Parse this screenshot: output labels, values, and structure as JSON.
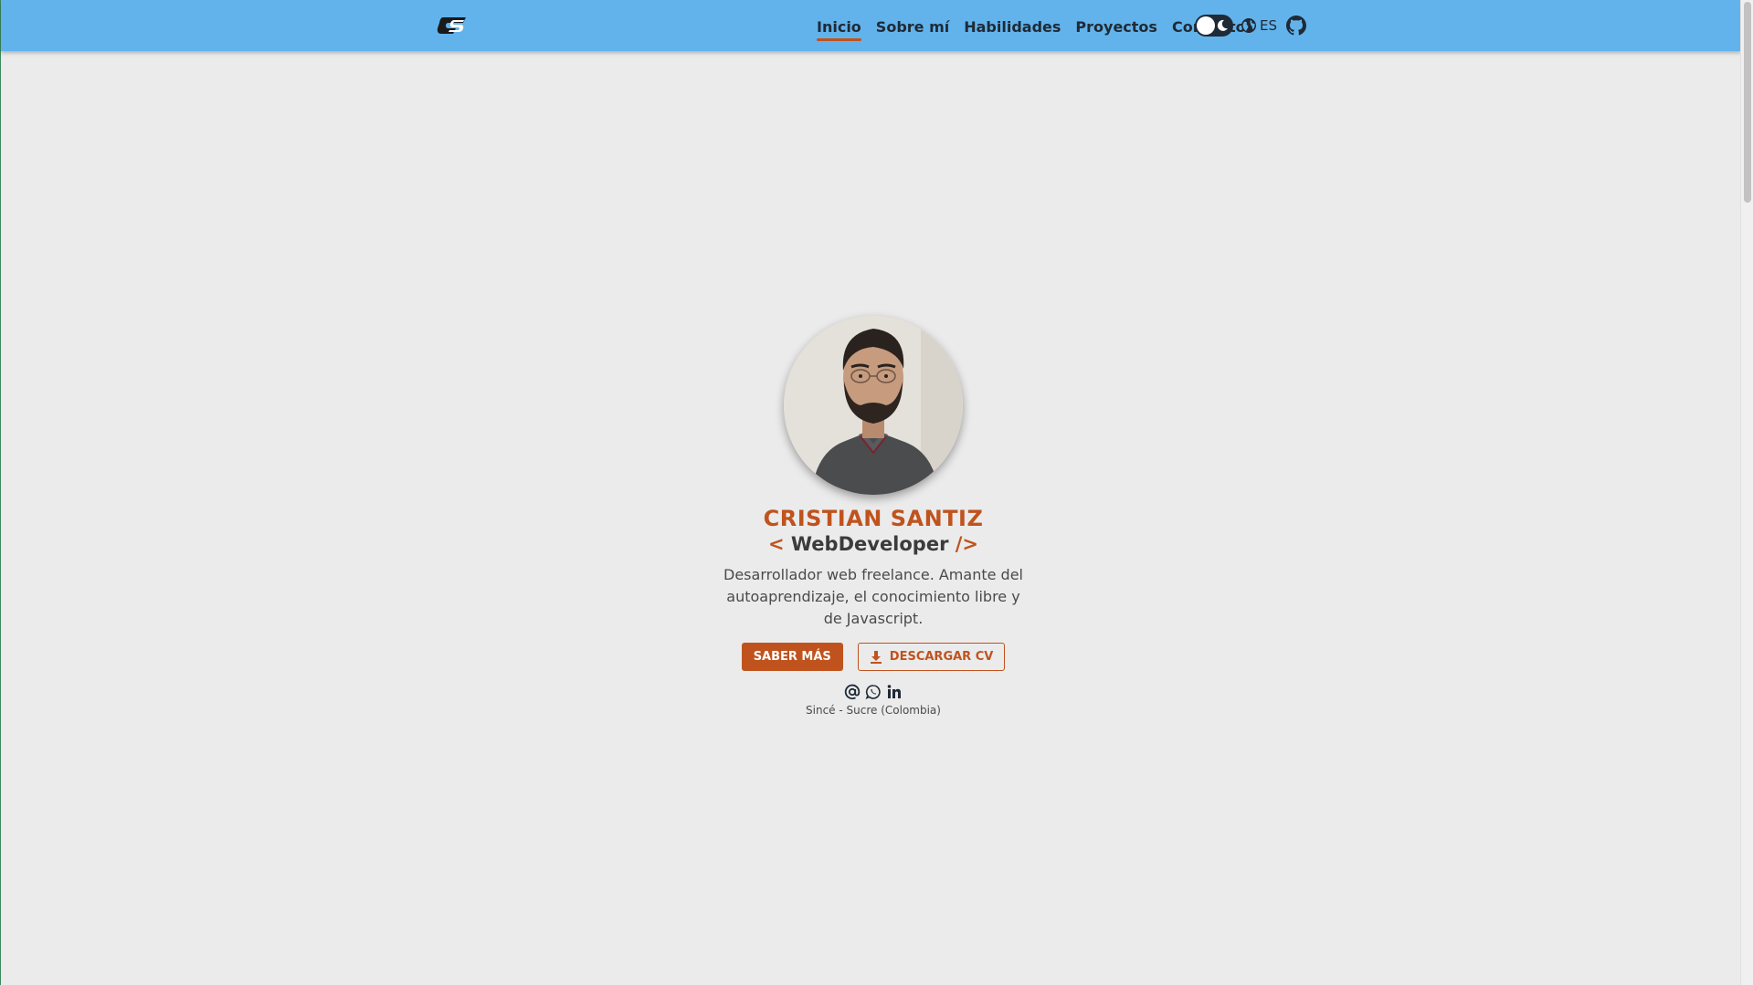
{
  "navbar": {
    "logo_icon": "cs-logo-icon",
    "links": [
      {
        "label": "Inicio",
        "active": true
      },
      {
        "label": "Sobre mí",
        "active": false
      },
      {
        "label": "Habilidades",
        "active": false
      },
      {
        "label": "Proyectos",
        "active": false
      },
      {
        "label": "Contacto",
        "active": false
      }
    ],
    "theme_toggle": {
      "icon": "moon-icon",
      "dark_mode": false
    },
    "language": {
      "icon": "globe-icon",
      "label": "ES"
    },
    "github_icon": "github-icon"
  },
  "hero": {
    "name": "CRISTIAN SANTIZ",
    "role": {
      "open": "<",
      "text": "WebDeveloper",
      "close": "/>"
    },
    "description": "Desarrollador web freelance. Amante del autoaprendizaje, el conocimiento libre y de Javascript.",
    "primary_button": "SABER MÁS",
    "secondary_button": {
      "label": "DESCARGAR CV",
      "icon": "download-icon"
    },
    "socials": [
      "at-icon",
      "whatsapp-icon",
      "linkedin-icon"
    ],
    "location": "Sincé - Sucre (Colombia)"
  },
  "colors": {
    "navbar": "#62b3eb",
    "accent": "#c0531d",
    "background": "#ebebeb",
    "text": "#1f2a36"
  }
}
